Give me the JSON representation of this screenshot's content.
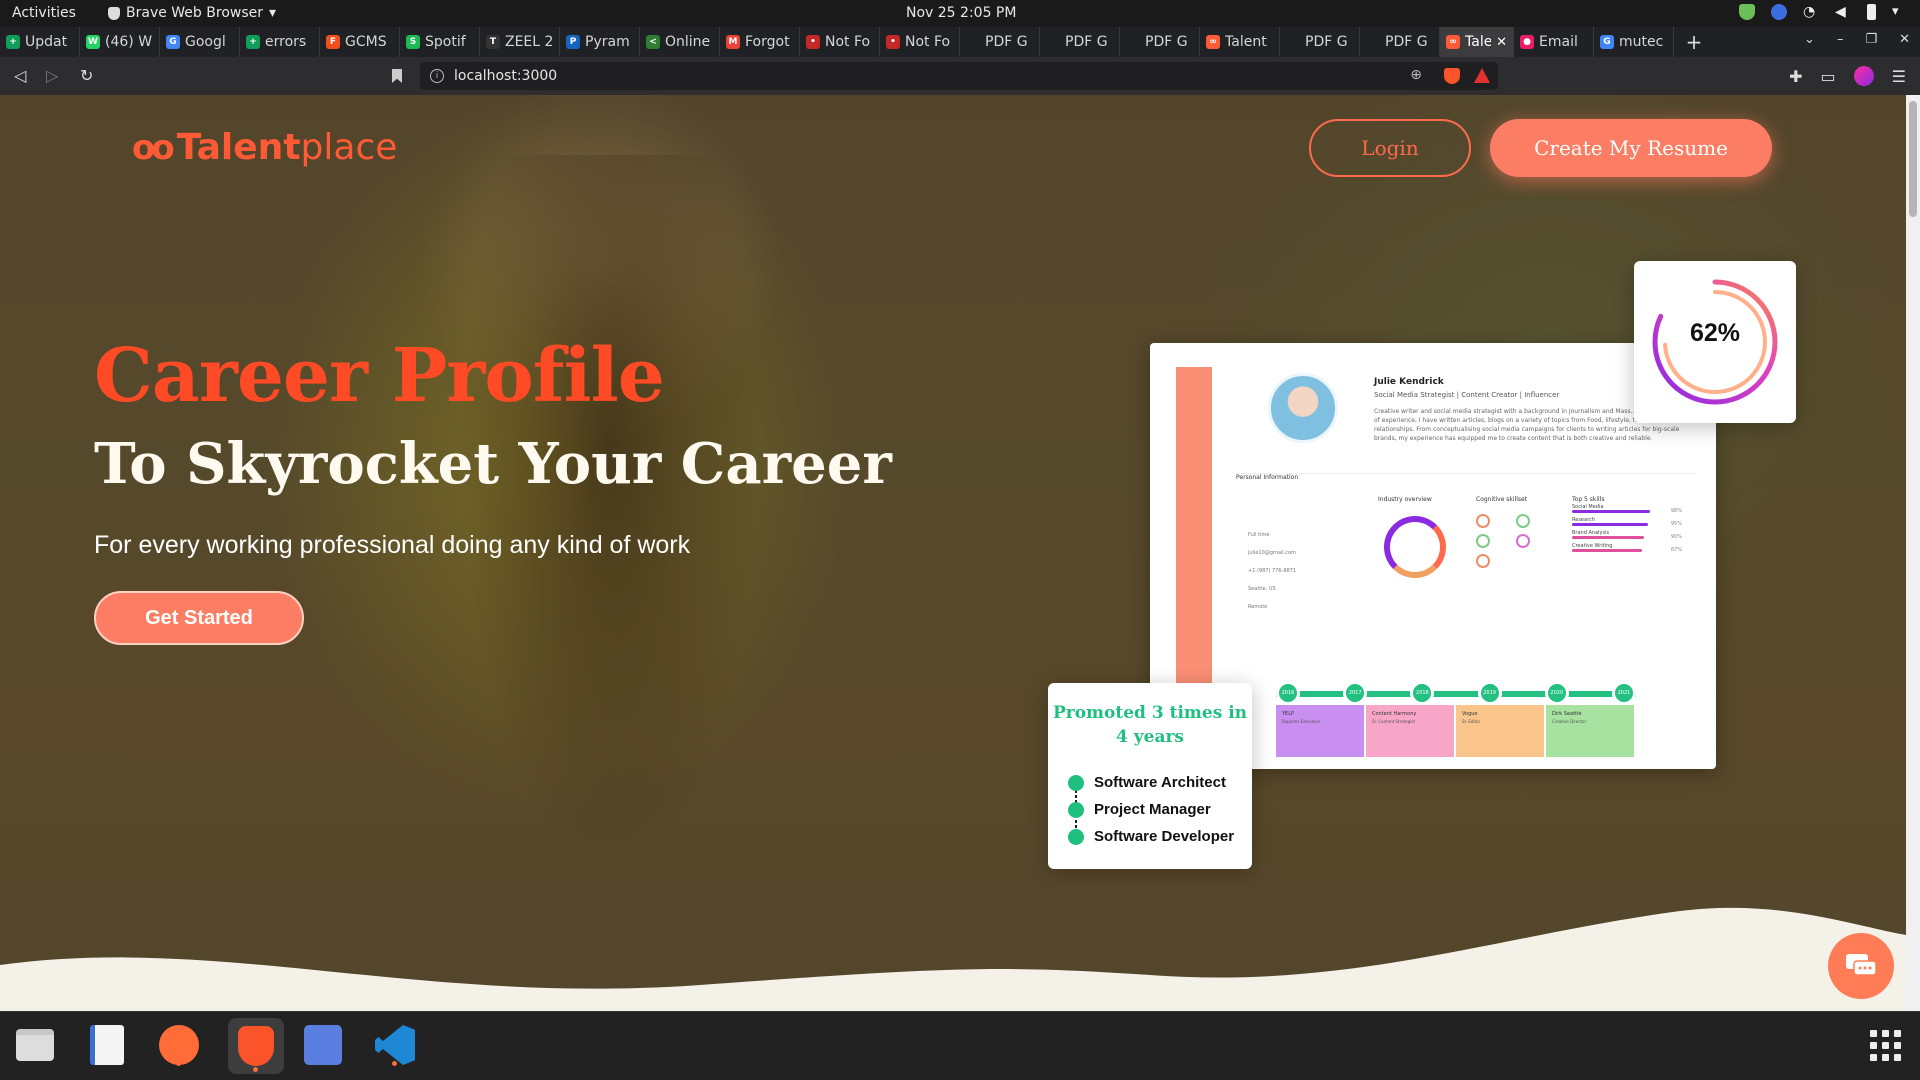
{
  "system": {
    "activities": "Activities",
    "app_name": "Brave Web Browser",
    "clock": "Nov 25  2:05 PM"
  },
  "tabs": [
    {
      "label": "Updat",
      "color": "#0f9d58",
      "glyph": "+"
    },
    {
      "label": "(46) W",
      "color": "#25d366",
      "glyph": "W"
    },
    {
      "label": "Googl",
      "color": "#4285f4",
      "glyph": "G"
    },
    {
      "label": "errors",
      "color": "#0f9d58",
      "glyph": "+"
    },
    {
      "label": "GCMS",
      "color": "#f24e1e",
      "glyph": "F"
    },
    {
      "label": "Spotif",
      "color": "#1db954",
      "glyph": "S"
    },
    {
      "label": "ZEEL 2",
      "color": "#333333",
      "glyph": "T"
    },
    {
      "label": "Pyram",
      "color": "#1565c0",
      "glyph": "P"
    },
    {
      "label": "Online",
      "color": "#2e7d32",
      "glyph": "<"
    },
    {
      "label": "Forgot",
      "color": "#ea4335",
      "glyph": "M"
    },
    {
      "label": "Not Fo",
      "color": "#c62828",
      "glyph": "•"
    },
    {
      "label": "Not Fo",
      "color": "#c62828",
      "glyph": "•"
    },
    {
      "label": "PDF G",
      "color": "#202124",
      "glyph": ""
    },
    {
      "label": "PDF G",
      "color": "#202124",
      "glyph": ""
    },
    {
      "label": "PDF G",
      "color": "#202124",
      "glyph": ""
    },
    {
      "label": "Talent",
      "color": "#ff5a36",
      "glyph": "∞"
    },
    {
      "label": "PDF G",
      "color": "#202124",
      "glyph": ""
    },
    {
      "label": "PDF G",
      "color": "#202124",
      "glyph": ""
    },
    {
      "label": "Tale",
      "color": "#ff5a36",
      "glyph": "∞",
      "active": true
    },
    {
      "label": "Email",
      "color": "#e91e63",
      "glyph": "●"
    },
    {
      "label": "mutec",
      "color": "#4285f4",
      "glyph": "G"
    }
  ],
  "url": "localhost:3000",
  "page": {
    "logo_mark": "oo",
    "logo_bold": "Talent",
    "logo_rest": "place",
    "login_label": "Login",
    "create_resume_label": "Create My Resume",
    "hero_title": "Career Profile",
    "hero_subtitle": "To Skyrocket Your Career",
    "hero_text": "For every working professional doing any kind of work",
    "get_started_label": "Get Started",
    "accent": "#ff5a36",
    "green": "#1fc07f"
  },
  "resume_preview": {
    "name": "Julie Kendrick",
    "role": "Social Media Strategist | Content Creator | Influencer",
    "bio": "Creative writer and social media strategist with a background in Journalism and Mass... With over 6 years of experience, I have written articles, blogs on a variety of topics from Food, lifestyle, fashion and relationships. From conceptualising social media campaigns for clients to writing articles for big-scale brands, my experience has equipped me to create content that is both creative and reliable.",
    "section_personal": "Personal Information",
    "section_industry": "Industry overview",
    "section_cognitive": "Cognitive skillset",
    "section_top_skills": "Top 5 skills",
    "personal": [
      "Full time",
      "julie10@gmail.com",
      "+1 (987) 776-8871",
      "Seattle, US",
      "Remote"
    ],
    "skills": [
      {
        "name": "Social Media",
        "pct": "98%",
        "level": 0.98,
        "color": "#8a2be2"
      },
      {
        "name": "Research",
        "pct": "95%",
        "level": 0.95,
        "color": "#8a2be2"
      },
      {
        "name": "Brand Analysis",
        "pct": "90%",
        "level": 0.9,
        "color": "#e04f9a"
      },
      {
        "name": "Creative Writing",
        "pct": "87%",
        "level": 0.87,
        "color": "#e04f9a"
      }
    ],
    "timeline_years": [
      "2016",
      "2017",
      "2018",
      "2019",
      "2020",
      "2021"
    ],
    "timeline_blocks": [
      {
        "company": "YELP",
        "title": "Reporter Executive",
        "color": "#c98ff0"
      },
      {
        "company": "Content Harmony",
        "title": "Sr. Content Strategist",
        "color": "#f7a6c8"
      },
      {
        "company": "Vogue",
        "title": "Sr. Editor",
        "color": "#f9c58a"
      },
      {
        "company": "Dirk Seattle",
        "title": "Creative Director",
        "color": "#a7e2a1"
      }
    ]
  },
  "gauge": {
    "label": "62%",
    "value": 0.62
  },
  "promotion": {
    "headline": "Promoted 3 times in 4 years",
    "roles": [
      "Software Architect",
      "Project Manager",
      "Software Developer"
    ]
  }
}
